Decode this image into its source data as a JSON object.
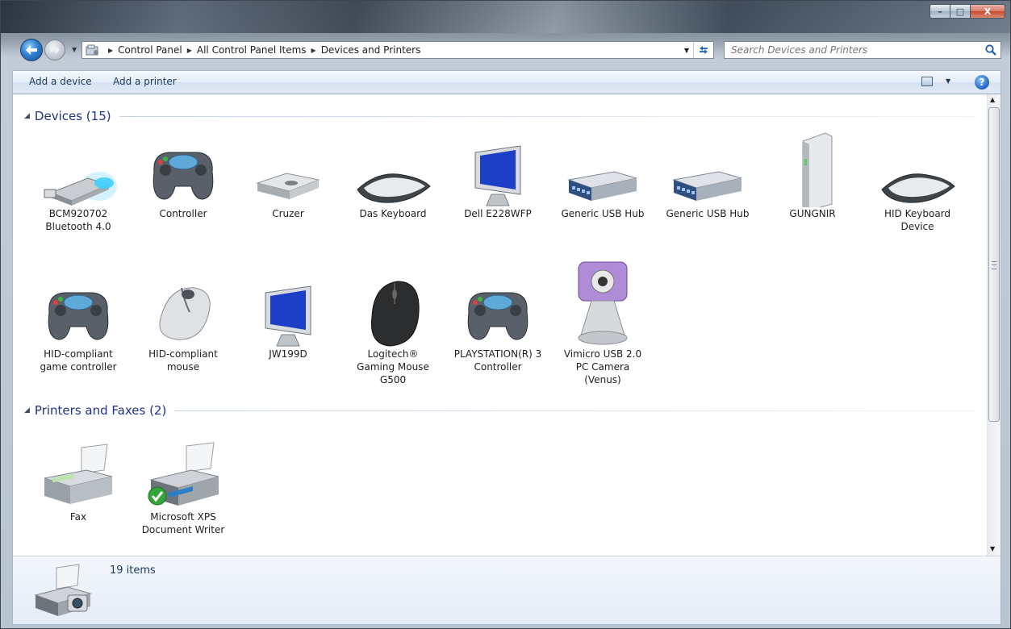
{
  "window": {
    "caption_buttons": {
      "minimize": "–",
      "maximize": "□",
      "close": "X"
    }
  },
  "navigation": {
    "back_icon": "back-arrow-icon",
    "forward_icon": "forward-arrow-icon",
    "breadcrumbs": [
      "Control Panel",
      "All Control Panel Items",
      "Devices and Printers"
    ],
    "search_placeholder": "Search Devices and Printers"
  },
  "commandbar": {
    "add_device": "Add a device",
    "add_printer": "Add a printer"
  },
  "groups": {
    "devices": {
      "title": "Devices (15)",
      "items": [
        {
          "label": "BCM920702 Bluetooth 4.0",
          "icon": "bluetooth-dongle-icon"
        },
        {
          "label": "Controller",
          "icon": "gamepad-icon"
        },
        {
          "label": "Cruzer",
          "icon": "usb-drive-icon"
        },
        {
          "label": "Das Keyboard",
          "icon": "keyboard-icon"
        },
        {
          "label": "Dell E228WFP",
          "icon": "monitor-icon"
        },
        {
          "label": "Generic USB Hub",
          "icon": "usb-hub-icon"
        },
        {
          "label": "Generic USB Hub",
          "icon": "usb-hub-icon"
        },
        {
          "label": "GUNGNIR",
          "icon": "tower-pc-icon"
        },
        {
          "label": "HID Keyboard Device",
          "icon": "keyboard-icon"
        },
        {
          "label": "HID-compliant game controller",
          "icon": "gamepad-icon"
        },
        {
          "label": "HID-compliant mouse",
          "icon": "mouse-icon"
        },
        {
          "label": "JW199D",
          "icon": "monitor-icon"
        },
        {
          "label": "Logitech® Gaming Mouse G500",
          "icon": "gaming-mouse-icon"
        },
        {
          "label": "PLAYSTATION(R) 3 Controller",
          "icon": "gamepad-icon"
        },
        {
          "label": "Vimicro USB 2.0 PC Camera (Venus)",
          "icon": "webcam-icon"
        }
      ]
    },
    "printers": {
      "title": "Printers and Faxes (2)",
      "items": [
        {
          "label": "Fax",
          "icon": "fax-icon"
        },
        {
          "label": "Microsoft XPS Document Writer",
          "icon": "printer-icon",
          "default": true
        }
      ]
    }
  },
  "details": {
    "count": "19 items",
    "icon": "devices-and-printers-icon"
  },
  "colors": {
    "group_header": "#1e3287",
    "command_text": "#1e395b"
  }
}
